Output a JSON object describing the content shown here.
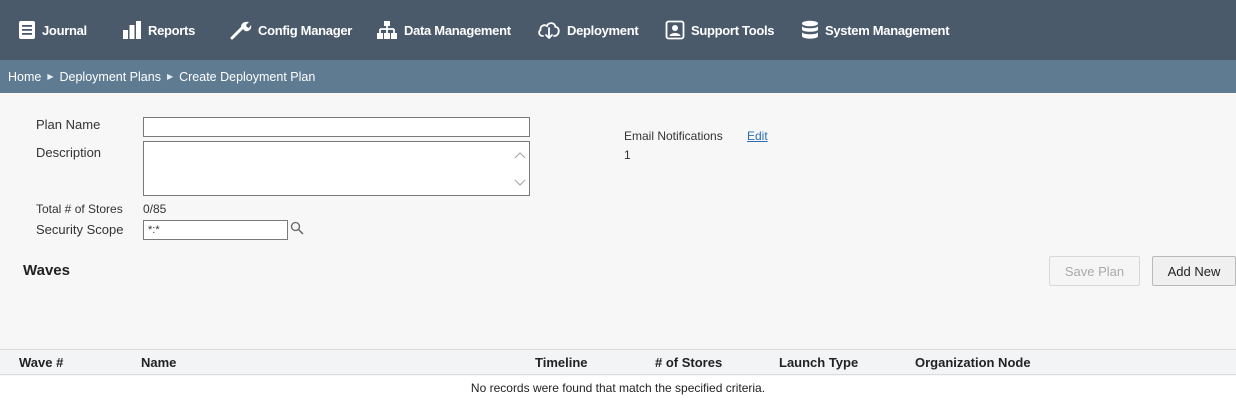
{
  "nav": {
    "items": [
      {
        "label": "Journal",
        "icon": "journal-icon"
      },
      {
        "label": "Reports",
        "icon": "bar-chart-icon"
      },
      {
        "label": "Config Manager",
        "icon": "wrench-icon"
      },
      {
        "label": "Data Management",
        "icon": "hierarchy-icon"
      },
      {
        "label": "Deployment",
        "icon": "cloud-download-icon"
      },
      {
        "label": "Support Tools",
        "icon": "support-person-icon"
      },
      {
        "label": "System Management",
        "icon": "database-icon"
      }
    ]
  },
  "breadcrumb": {
    "items": [
      "Home",
      "Deployment Plans",
      "Create Deployment Plan"
    ],
    "separator": "▶"
  },
  "form": {
    "plan_name_label": "Plan Name",
    "plan_name_value": "",
    "description_label": "Description",
    "description_value": "",
    "total_stores_label": "Total # of Stores",
    "total_stores_value": "0/85",
    "security_scope_label": "Security Scope",
    "security_scope_value": "*:*",
    "email_notifications_label": "Email Notifications",
    "email_notifications_edit": "Edit",
    "email_notifications_count": "1"
  },
  "waves": {
    "title": "Waves",
    "save_button": "Save Plan",
    "add_button": "Add New"
  },
  "grid": {
    "columns": [
      "Wave #",
      "Name",
      "Timeline",
      "# of Stores",
      "Launch Type",
      "Organization Node"
    ],
    "empty_message": "No records were found that match the specified criteria."
  },
  "colors": {
    "nav_bg": "#4a5a6b",
    "breadcrumb_bg": "#5f7b92",
    "link": "#2a6db0"
  }
}
